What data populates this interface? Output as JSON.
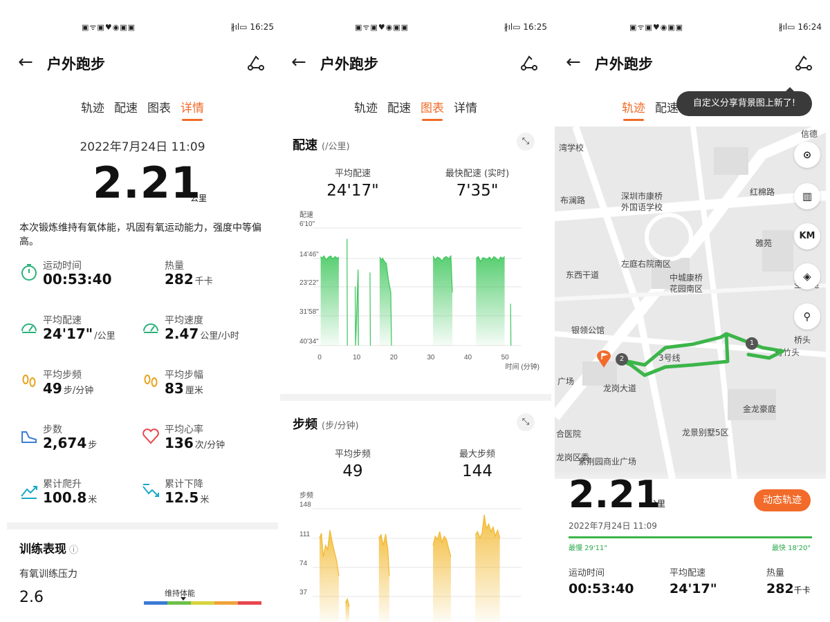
{
  "status": {
    "icons": "▣ᯤ▣♥◉▣▣",
    "right_1": "∦ıl▭ 16:25",
    "right_2": "∦ıl▭ 16:25",
    "right_3": "∦ıl▭ 16:24"
  },
  "header": {
    "back": "←",
    "title": "户外跑步"
  },
  "tabs": [
    "轨迹",
    "配速",
    "图表",
    "详情"
  ],
  "details": {
    "date": "2022年7月24日 11:09",
    "distance": "2.21",
    "distance_unit": "公里",
    "description": "本次锻炼维持有氧体能，巩固有氧运动能力，强度中等偏高。",
    "stats": [
      {
        "label": "运动时间",
        "value": "00:53:40",
        "unit": "",
        "icon": "timer-icon",
        "color": "#2ab17a"
      },
      {
        "label": "热量",
        "value": "282",
        "unit": "千卡",
        "icon": "flame-icon",
        "color": "#f07a3a"
      },
      {
        "label": "平均配速",
        "value": "24'17\"",
        "unit": "/公里",
        "icon": "speedometer-icon",
        "color": "#2ab17a"
      },
      {
        "label": "平均速度",
        "value": "2.47",
        "unit": "公里/小时",
        "icon": "speedometer-icon",
        "color": "#2ab17a"
      },
      {
        "label": "平均步频",
        "value": "49",
        "unit": "步/分钟",
        "icon": "footprints-icon",
        "color": "#e6a21c"
      },
      {
        "label": "平均步幅",
        "value": "83",
        "unit": "厘米",
        "icon": "footprints-icon",
        "color": "#e6a21c"
      },
      {
        "label": "步数",
        "value": "2,674",
        "unit": "步",
        "icon": "shoe-icon",
        "color": "#3a7bd5"
      },
      {
        "label": "平均心率",
        "value": "136",
        "unit": "次/分钟",
        "icon": "heart-icon",
        "color": "#e8474e"
      },
      {
        "label": "累计爬升",
        "value": "100.8",
        "unit": "米",
        "icon": "climb-icon",
        "color": "#19a8c9"
      },
      {
        "label": "累计下降",
        "value": "12.5",
        "unit": "米",
        "icon": "descent-icon",
        "color": "#19a8c9"
      }
    ],
    "training_title": "训练表现",
    "aerobic_label": "有氧训练压力",
    "aerobic_value": "2.6",
    "aerobic_bar_label": "维持体能",
    "bar_colors": [
      "#3a7bd5",
      "#6cc04a",
      "#d7d33b",
      "#f0a33a",
      "#e8474e"
    ]
  },
  "charts": {
    "pace_title": "配速",
    "pace_unit": "(/公里)",
    "avg_pace_label": "平均配速",
    "avg_pace": "24'17\"",
    "fast_pace_label": "最快配速 (实时)",
    "fast_pace": "7'35\"",
    "pace_axis_title": "配速",
    "cad_title": "步频",
    "cad_unit": "(步/分钟)",
    "avg_cad_label": "平均步频",
    "avg_cad": "49",
    "max_cad_label": "最大步频",
    "max_cad": "144",
    "cad_axis_title": "步频",
    "expand": "⤡"
  },
  "chart_data": [
    {
      "type": "area",
      "title": "配速",
      "xlabel": "时间 (分钟)",
      "ylabel": "配速",
      "xticks": [
        "0",
        "10",
        "20",
        "30",
        "40",
        "50"
      ],
      "yticks": [
        "6'10\"",
        "14'46\"",
        "23'22\"",
        "31'58\"",
        "40'34\""
      ],
      "xlim": [
        0,
        53.7
      ],
      "ylim_seconds": [
        370,
        2434
      ],
      "color": "#3cc65a",
      "series": [
        {
          "values": [
            [
              0.3,
              870
            ],
            [
              0.6,
              900
            ],
            [
              1.2,
              860
            ],
            [
              1.8,
              930
            ],
            [
              2.4,
              880
            ],
            [
              3,
              860
            ],
            [
              3.6,
              910
            ],
            [
              4.2,
              870
            ],
            [
              4.8,
              900
            ],
            [
              5.2,
              880
            ],
            [
              7.4,
              560
            ],
            [
              7.5,
              2434
            ],
            [
              9.6,
              1400
            ],
            [
              9.7,
              2434
            ],
            [
              10.4,
              1100
            ],
            [
              10.5,
              2434
            ],
            [
              13.6,
              1150
            ],
            [
              13.7,
              2434
            ],
            [
              16.2,
              880
            ],
            [
              16.6,
              930
            ],
            [
              17,
              900
            ],
            [
              17.5,
              960
            ],
            [
              18,
              990
            ],
            [
              18.6,
              1300
            ],
            [
              19.2,
              1500
            ],
            [
              19.4,
              2434
            ],
            [
              30.6,
              860
            ],
            [
              31.2,
              930
            ],
            [
              31.8,
              880
            ],
            [
              32.4,
              900
            ],
            [
              33,
              950
            ],
            [
              33.6,
              890
            ],
            [
              34.2,
              870
            ],
            [
              34.8,
              910
            ],
            [
              35.4,
              860
            ],
            [
              35.8,
              1500
            ],
            [
              42.2,
              900
            ],
            [
              42.8,
              870
            ],
            [
              43.4,
              960
            ],
            [
              44,
              890
            ],
            [
              44.6,
              900
            ],
            [
              45.2,
              920
            ],
            [
              45.8,
              880
            ],
            [
              46.4,
              930
            ],
            [
              47,
              870
            ],
            [
              47.6,
              900
            ],
            [
              48.2,
              940
            ],
            [
              48.8,
              880
            ],
            [
              49.4,
              900
            ],
            [
              49.9,
              870
            ],
            [
              51.5,
              1700
            ],
            [
              51.6,
              2434
            ]
          ]
        }
      ]
    },
    {
      "type": "area",
      "title": "步频",
      "ylabel": "步频",
      "yticks": [
        "148",
        "111",
        "74",
        "37"
      ],
      "ylim": [
        0,
        148
      ],
      "color": "#f2b82e",
      "series": [
        {
          "values": [
            [
              0,
              110
            ],
            [
              0.5,
              116
            ],
            [
              1,
              85
            ],
            [
              1.6,
              100
            ],
            [
              2.2,
              95
            ],
            [
              2.8,
              120
            ],
            [
              3.4,
              105
            ],
            [
              4,
              92
            ],
            [
              4.6,
              80
            ],
            [
              5.2,
              60
            ],
            [
              7,
              25
            ],
            [
              7.5,
              30
            ],
            [
              8,
              20
            ],
            [
              16,
              110
            ],
            [
              16.6,
              114
            ],
            [
              17.2,
              100
            ],
            [
              17.8,
              115
            ],
            [
              18.4,
              95
            ],
            [
              18.8,
              60
            ],
            [
              30.6,
              100
            ],
            [
              31.2,
              112
            ],
            [
              31.8,
              108
            ],
            [
              32.4,
              118
            ],
            [
              33,
              104
            ],
            [
              33.6,
              112
            ],
            [
              34.2,
              108
            ],
            [
              34.8,
              96
            ],
            [
              35.4,
              85
            ],
            [
              42,
              114
            ],
            [
              42.6,
              118
            ],
            [
              43.2,
              110
            ],
            [
              43.8,
              116
            ],
            [
              44.4,
              140
            ],
            [
              45,
              122
            ],
            [
              45.6,
              128
            ],
            [
              46.2,
              118
            ],
            [
              46.8,
              124
            ],
            [
              47.4,
              112
            ],
            [
              48,
              120
            ],
            [
              48.6,
              110
            ]
          ]
        }
      ]
    }
  ],
  "map": {
    "tooltip": "自定义分享背景图上新了!",
    "labels": [
      "湾学校",
      "信德",
      "深圳市康桥",
      "外国语学校",
      "红棉路",
      "布澜路",
      "东西干道",
      "左庭右院南区",
      "中城康桥",
      "花园南区",
      "银领公馆",
      "丹竹头",
      "金龙豪庭",
      "龙岗大道",
      "3号线",
      "龙景别墅5区",
      "合医院",
      "紫荆园商业广场",
      "龙岗区委",
      "桥头",
      "广场",
      "雅苑",
      "圣廷苑"
    ],
    "buttons": [
      "⊙",
      "▥",
      "KM",
      "◈",
      "⚲"
    ],
    "distance": "2.21",
    "distance_unit": "公里",
    "dyn_button": "动态轨迹",
    "date": "2022年7月24日 11:09",
    "slowest": "最慢 29'11\"",
    "fastest": "最快 18'20\"",
    "bottom_stats": [
      {
        "label": "运动时间",
        "value": "00:53:40",
        "unit": ""
      },
      {
        "label": "平均配速",
        "value": "24'17\"",
        "unit": ""
      },
      {
        "label": "热量",
        "value": "282",
        "unit": "千卡"
      }
    ],
    "route_color": "#3cb54a",
    "pin_labels": [
      "1",
      "2"
    ]
  }
}
